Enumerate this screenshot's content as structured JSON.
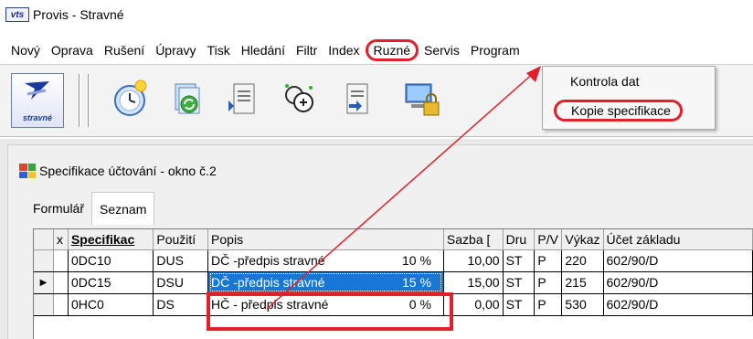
{
  "window": {
    "logo_text": "vts",
    "title": "Provis - Stravné"
  },
  "menu": [
    "Nový",
    "Oprava",
    "Rušení",
    "Úpravy",
    "Tisk",
    "Hledání",
    "Filtr",
    "Index",
    "Ruzné",
    "Servis",
    "Program"
  ],
  "menu_active_index": 8,
  "dropdown": {
    "items": [
      "Kontrola dat",
      "Kopie specifikace"
    ],
    "highlighted_index": 1
  },
  "toolbar": {
    "logo_text": "stravné"
  },
  "subwindow": {
    "title": "Specifikace účtování - okno č.2",
    "tabs": [
      "Formulář",
      "Seznam"
    ],
    "active_tab": 1
  },
  "table": {
    "columns": [
      "x",
      "Specifikac",
      "Použití",
      "Popis",
      "Sazba",
      "Dru",
      "P/V",
      "Výkaz",
      "Účet základu"
    ],
    "header_display": [
      "x",
      "Specifikac",
      "Použití",
      "Popis",
      "Sazba [",
      "Dru",
      "P/V",
      "Výkaz",
      "Účet základu"
    ],
    "rows": [
      {
        "spec": "0DC10",
        "use": "DUS",
        "desc": "DČ -předpis stravné",
        "pct": "10 %",
        "rate": "10,00",
        "kind": "ST",
        "pv": "P",
        "report": "220",
        "account": "602/90/D"
      },
      {
        "spec": "0DC15",
        "use": "DSU",
        "desc": "DČ -předpis stravné",
        "pct": "15 %",
        "rate": "15,00",
        "kind": "ST",
        "pv": "P",
        "report": "215",
        "account": "602/90/D"
      },
      {
        "spec": "0HC0",
        "use": "DS",
        "desc": "HČ - předpis stravné",
        "pct": "0 %",
        "rate": "0,00",
        "kind": "ST",
        "pv": "P",
        "report": "530",
        "account": "602/90/D"
      }
    ],
    "current_row": 1
  },
  "colors": {
    "annotation": "#e0202a",
    "selection": "#1677d6"
  }
}
